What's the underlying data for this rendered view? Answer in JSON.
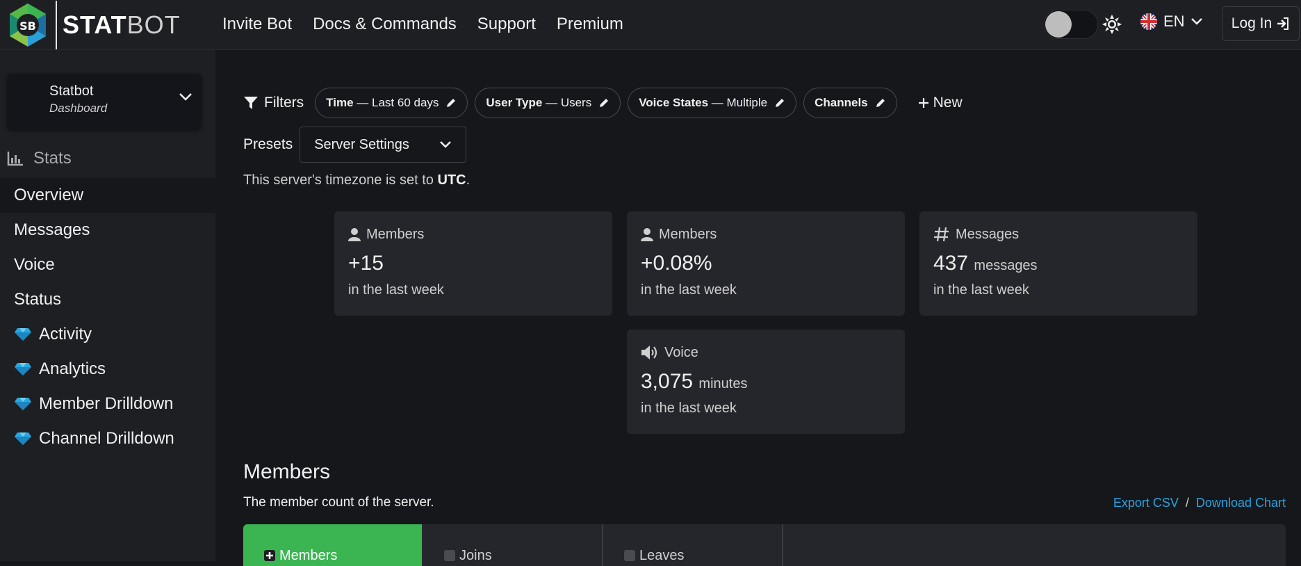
{
  "header": {
    "logo_badge": "SB",
    "logo_bold": "STAT",
    "logo_light": "BOT",
    "nav": [
      "Invite Bot",
      "Docs & Commands",
      "Support",
      "Premium"
    ],
    "language": "EN",
    "login_label": "Log In"
  },
  "sidebar": {
    "dashboard_title": "Statbot",
    "dashboard_subtitle": "Dashboard",
    "stats_heading": "Stats",
    "items": [
      {
        "label": "Overview",
        "premium": false,
        "active": true
      },
      {
        "label": "Messages",
        "premium": false,
        "active": false
      },
      {
        "label": "Voice",
        "premium": false,
        "active": false
      },
      {
        "label": "Status",
        "premium": false,
        "active": false
      },
      {
        "label": "Activity",
        "premium": true,
        "active": false
      },
      {
        "label": "Analytics",
        "premium": true,
        "active": false
      },
      {
        "label": "Member Drilldown",
        "premium": true,
        "active": false
      },
      {
        "label": "Channel Drilldown",
        "premium": true,
        "active": false
      }
    ]
  },
  "filters": {
    "label": "Filters",
    "pills": [
      {
        "key": "Time",
        "value": "— Last 60 days"
      },
      {
        "key": "User Type",
        "value": "— Users"
      },
      {
        "key": "Voice States",
        "value": "— Multiple"
      },
      {
        "key": "Channels",
        "value": ""
      }
    ],
    "new_label": "New"
  },
  "presets": {
    "label": "Presets",
    "selected": "Server Settings"
  },
  "timezone": {
    "prefix": "This server's timezone is set to ",
    "zone": "UTC",
    "suffix": "."
  },
  "cards": [
    {
      "title": "Members",
      "icon": "user-icon",
      "value": "+15",
      "unit": "",
      "footer": "in the last week"
    },
    {
      "title": "Members",
      "icon": "user-icon",
      "value": "+0.08%",
      "unit": "",
      "footer": "in the last week"
    },
    {
      "title": "Messages",
      "icon": "hash-icon",
      "value": "437",
      "unit": "messages",
      "footer": "in the last week"
    },
    {
      "title": "Voice",
      "icon": "speaker-icon",
      "value": "3,075",
      "unit": "minutes",
      "footer": "in the last week"
    }
  ],
  "members_section": {
    "title": "Members",
    "subtitle": "The member count of the server.",
    "export_csv": "Export CSV",
    "separator": "/",
    "download_chart": "Download Chart",
    "tabs": [
      {
        "label": "Members",
        "checked": true
      },
      {
        "label": "Joins",
        "checked": false
      },
      {
        "label": "Leaves",
        "checked": false
      }
    ]
  },
  "colors": {
    "accent_green": "#3bb552",
    "link_blue": "#2aa3e0",
    "premium_gem": "#29a8e0"
  }
}
